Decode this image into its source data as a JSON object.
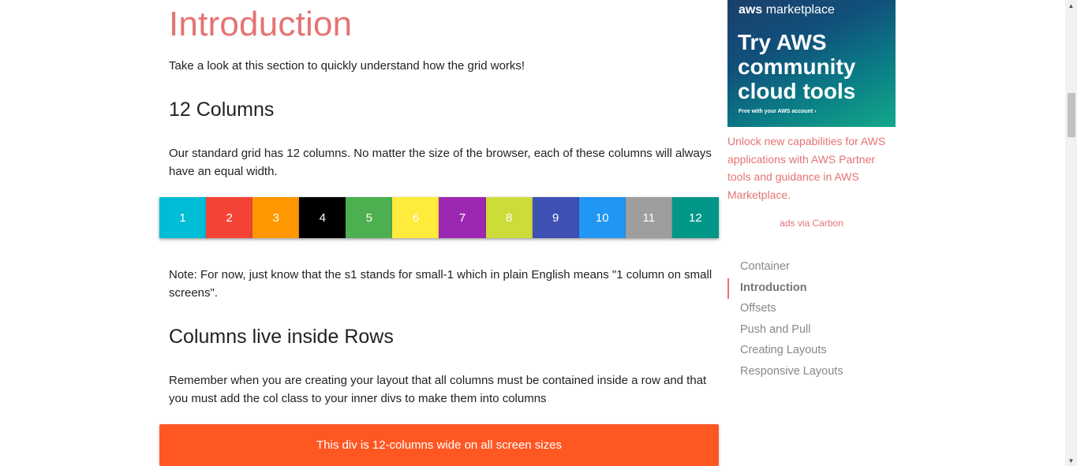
{
  "content": {
    "title": "Introduction",
    "intro": "Take a look at this section to quickly understand how the grid works!",
    "section1_heading": "12 Columns",
    "section1_text": "Our standard grid has 12 columns. No matter the size of the browser, each of these columns will always have an equal width.",
    "columns": [
      {
        "label": "1",
        "color": "#00bcd4"
      },
      {
        "label": "2",
        "color": "#f44336"
      },
      {
        "label": "3",
        "color": "#ff9800"
      },
      {
        "label": "4",
        "color": "#000000"
      },
      {
        "label": "5",
        "color": "#4caf50"
      },
      {
        "label": "6",
        "color": "#ffeb3b"
      },
      {
        "label": "7",
        "color": "#9c27b0"
      },
      {
        "label": "8",
        "color": "#cddc39"
      },
      {
        "label": "9",
        "color": "#3f51b5"
      },
      {
        "label": "10",
        "color": "#2196f3"
      },
      {
        "label": "11",
        "color": "#9e9e9e"
      },
      {
        "label": "12",
        "color": "#009688"
      }
    ],
    "note": "Note: For now, just know that the s1 stands for small-1 which in plain English means \"1 column on small screens\".",
    "section2_heading": "Columns live inside Rows",
    "section2_text": "Remember when you are creating your layout that all columns must be contained inside a row and that you must add the col class to your inner divs to make them into columns",
    "wide_bar_text": "This div is 12-columns wide on all screen sizes",
    "wide_bar_color": "#ff5722"
  },
  "sidebar": {
    "ad": {
      "logo_prefix": "aws",
      "logo_suffix": " marketplace",
      "headline_1": "Try AWS",
      "headline_2": "community",
      "headline_3": "cloud tools",
      "footnote": "Free with your AWS account ›",
      "description": "Unlock new capabilities for AWS applications with AWS Partner tools and guidance in AWS Marketplace.",
      "via": "ads via Carbon"
    },
    "toc": [
      {
        "label": "Container",
        "active": false
      },
      {
        "label": "Introduction",
        "active": true
      },
      {
        "label": "Offsets",
        "active": false
      },
      {
        "label": "Push and Pull",
        "active": false
      },
      {
        "label": "Creating Layouts",
        "active": false
      },
      {
        "label": "Responsive Layouts",
        "active": false
      }
    ],
    "accent_color": "#e57373"
  },
  "scrollbar": {
    "up_icon": "triangle-up",
    "down_icon": "triangle-down"
  }
}
